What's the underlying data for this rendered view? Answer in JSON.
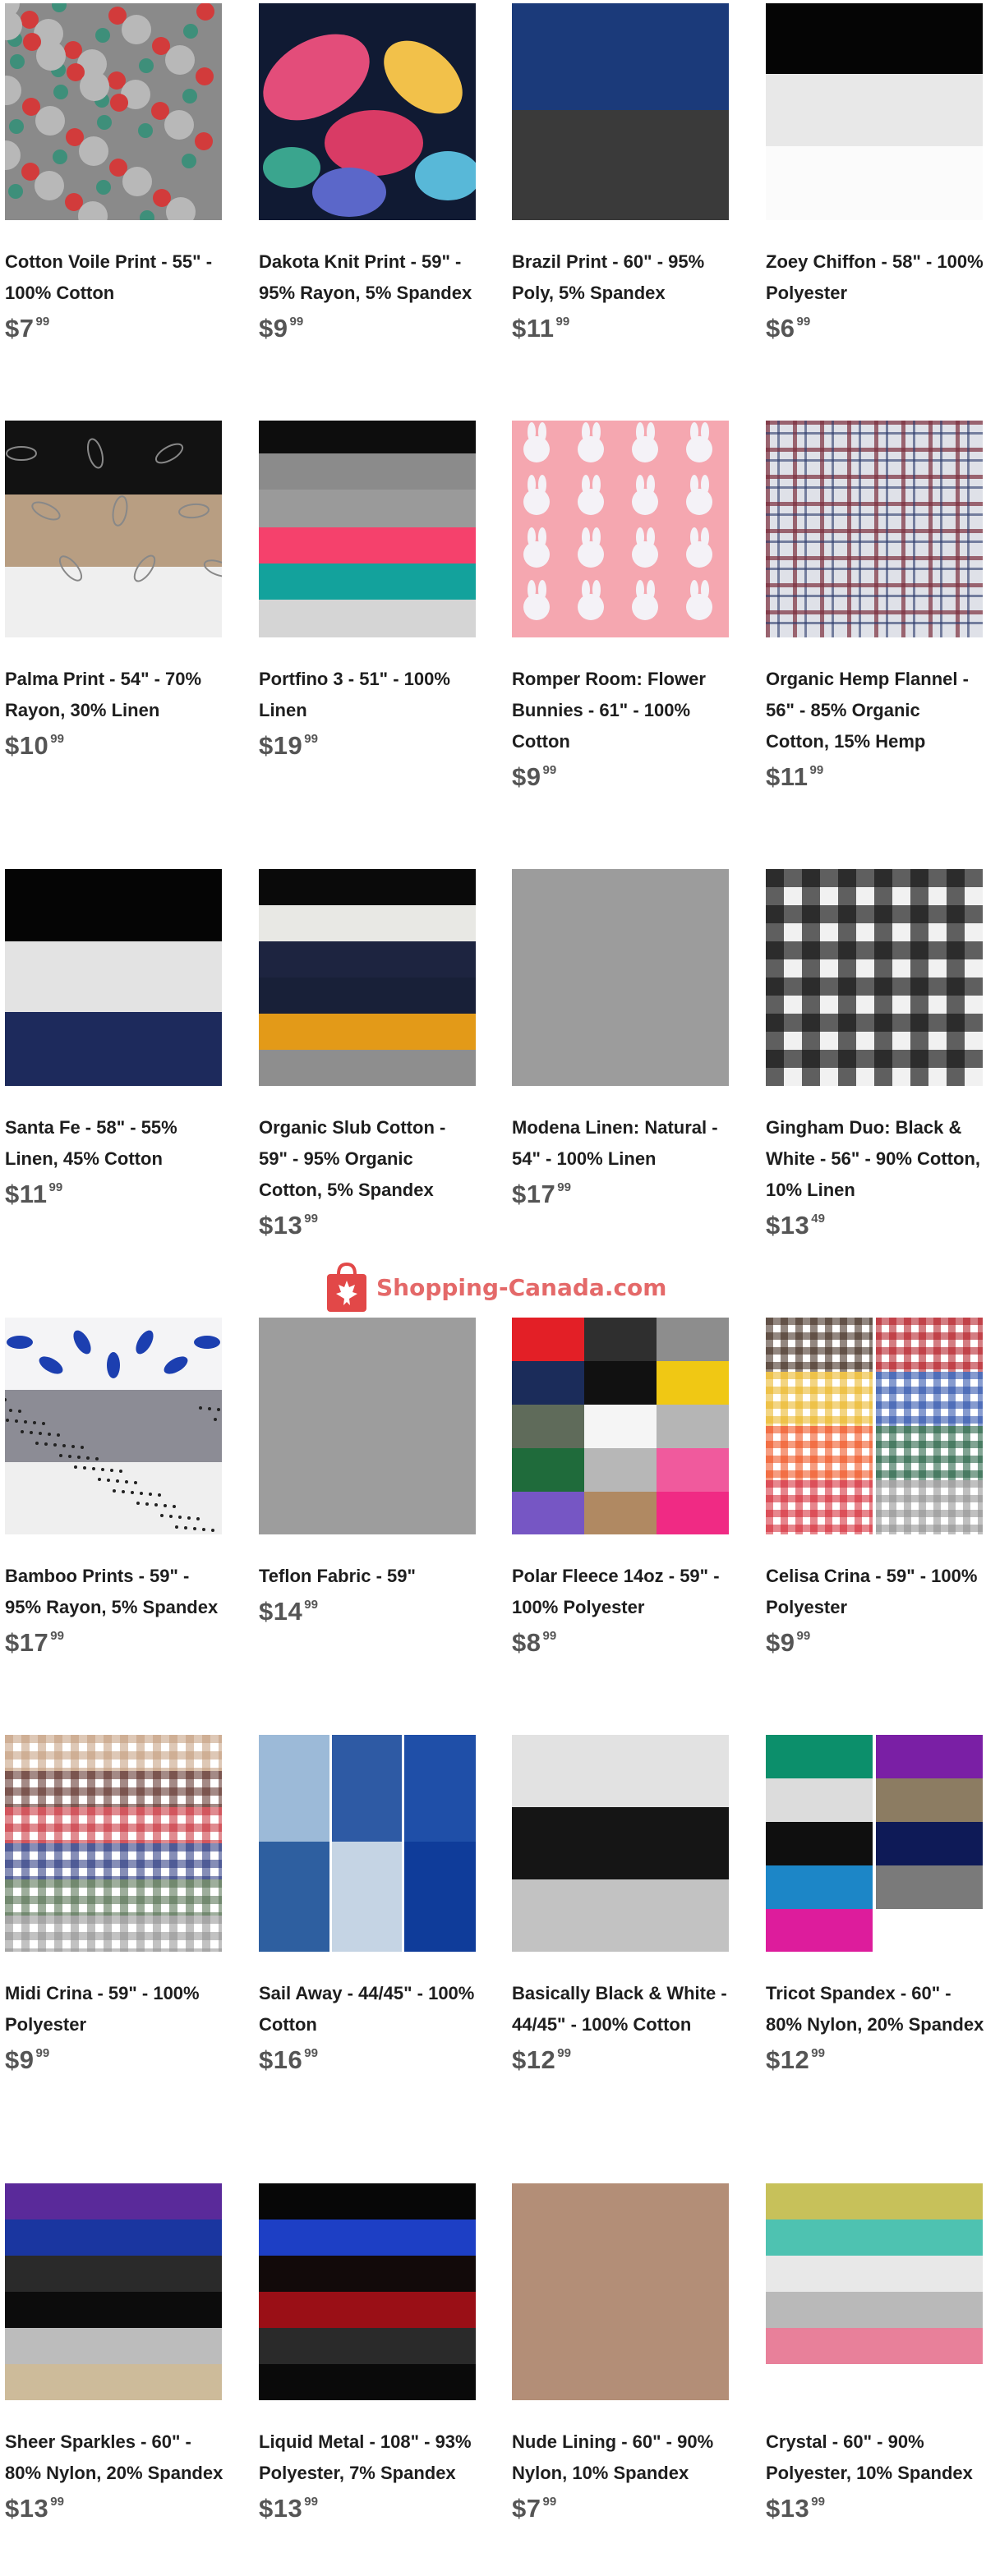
{
  "watermark": {
    "text": "Shopping-Canada.com",
    "icon": "maple-leaf-bag-icon"
  },
  "products": [
    {
      "title": "Cotton Voile Print - 55\" - 100% Cotton",
      "dollars": "$7",
      "cents": "99",
      "swatch": "roses"
    },
    {
      "title": "Dakota Knit Print - 59\" - 95% Rayon, 5% Spandex",
      "dollars": "$9",
      "cents": "99",
      "swatch": "floral"
    },
    {
      "title": "Brazil Print - 60\" - 95% Poly, 5% Spandex",
      "dollars": "$11",
      "cents": "99",
      "swatch": "blue-grey"
    },
    {
      "title": "Zoey Chiffon - 58\" - 100% Polyester",
      "dollars": "$6",
      "cents": "99",
      "swatch": "black-white"
    },
    {
      "title": "Palma Print - 54\" - 70% Rayon, 30% Linen",
      "dollars": "$10",
      "cents": "99",
      "swatch": "leaf-print"
    },
    {
      "title": "Portfino 3 - 51\" - 100% Linen",
      "dollars": "$19",
      "cents": "99",
      "swatch": "stripes-portfino"
    },
    {
      "title": "Romper Room: Flower Bunnies - 61\" - 100% Cotton",
      "dollars": "$9",
      "cents": "99",
      "swatch": "bunnies"
    },
    {
      "title": "Organic Hemp Flannel - 56\" - 85% Organic Cotton, 15% Hemp",
      "dollars": "$11",
      "cents": "99",
      "swatch": "plaid"
    },
    {
      "title": "Santa Fe - 58\" - 55% Linen, 45% Cotton",
      "dollars": "$11",
      "cents": "99",
      "swatch": "santa-fe"
    },
    {
      "title": "Organic Slub Cotton - 59\" - 95% Organic Cotton, 5% Spandex",
      "dollars": "$13",
      "cents": "99",
      "swatch": "slub"
    },
    {
      "title": "Modena Linen: Natural - 54\" - 100% Linen",
      "dollars": "$17",
      "cents": "99",
      "swatch": "grey-solid"
    },
    {
      "title": "Gingham Duo: Black & White - 56\" - 90% Cotton, 10% Linen",
      "dollars": "$13",
      "cents": "49",
      "swatch": "gingham"
    },
    {
      "title": "Bamboo Prints - 59\" - 95% Rayon, 5% Spandex",
      "dollars": "$17",
      "cents": "99",
      "swatch": "bamboo"
    },
    {
      "title": "Teflon Fabric - 59\"",
      "dollars": "$14",
      "cents": "99",
      "swatch": "teflon"
    },
    {
      "title": "Polar Fleece 14oz - 59\" - 100% Polyester",
      "dollars": "$8",
      "cents": "99",
      "swatch": "fleece-grid"
    },
    {
      "title": "Celisa Crina - 59\" - 100% Polyester",
      "dollars": "$9",
      "cents": "99",
      "swatch": "check-grid"
    },
    {
      "title": "Midi Crina - 59\" - 100% Polyester",
      "dollars": "$9",
      "cents": "99",
      "swatch": "midi-check"
    },
    {
      "title": "Sail Away - 44/45\" - 100% Cotton",
      "dollars": "$16",
      "cents": "99",
      "swatch": "sail"
    },
    {
      "title": "Basically Black & White - 44/45\" - 100% Cotton",
      "dollars": "$12",
      "cents": "99",
      "swatch": "basically"
    },
    {
      "title": "Tricot Spandex - 60\" - 80% Nylon, 20% Spandex",
      "dollars": "$12",
      "cents": "99",
      "swatch": "tricot"
    },
    {
      "title": "Sheer Sparkles - 60\" - 80% Nylon, 20% Spandex",
      "dollars": "$13",
      "cents": "99",
      "swatch": "sparkles"
    },
    {
      "title": "Liquid Metal - 108\" - 93% Polyester, 7% Spandex",
      "dollars": "$13",
      "cents": "99",
      "swatch": "liquid-metal"
    },
    {
      "title": "Nude Lining - 60\" - 90% Nylon, 10% Spandex",
      "dollars": "$7",
      "cents": "99",
      "swatch": "nude"
    },
    {
      "title": "Crystal - 60\" - 90% Polyester, 10% Spandex",
      "dollars": "$13",
      "cents": "99",
      "swatch": "crystal"
    }
  ]
}
